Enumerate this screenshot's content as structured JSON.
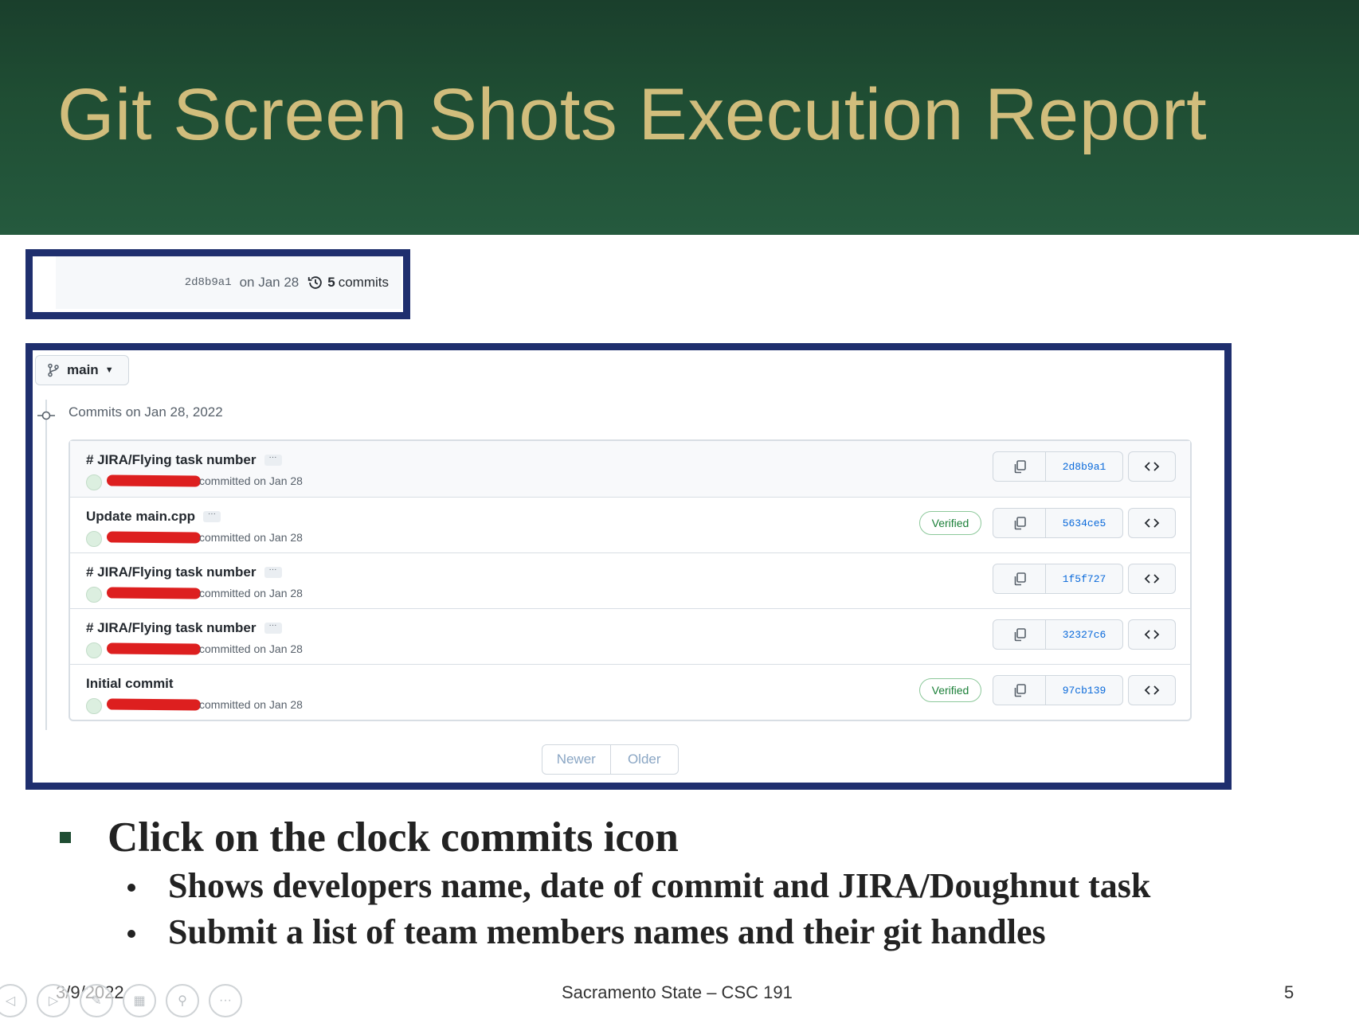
{
  "slide": {
    "title": "Git Screen Shots Execution Report",
    "footer_date": "3/9/2022",
    "footer_center": "Sacramento State – CSC 191",
    "page_number": "5"
  },
  "latest_commit": {
    "sha": "2d8b9a1",
    "date": "on Jan 28",
    "commits_count": "5",
    "commits_label": "commits"
  },
  "branch": {
    "name": "main"
  },
  "commit_group": {
    "date_label": "Commits on Jan 28, 2022"
  },
  "commits": [
    {
      "message": "# JIRA/Flying task number",
      "committed": "committed on Jan 28",
      "verified": "",
      "sha": "2d8b9a1"
    },
    {
      "message": "Update main.cpp",
      "committed": "committed on Jan 28",
      "verified": "Verified",
      "sha": "5634ce5"
    },
    {
      "message": "# JIRA/Flying task number",
      "committed": "committed on Jan 28",
      "verified": "",
      "sha": "1f5f727"
    },
    {
      "message": "# JIRA/Flying task number",
      "committed": "committed on Jan 28",
      "verified": "",
      "sha": "32327c6"
    },
    {
      "message": "Initial commit",
      "committed": "committed on Jan 28",
      "verified": "Verified",
      "sha": "97cb139"
    }
  ],
  "pagination": {
    "newer": "Newer",
    "older": "Older"
  },
  "bullets": {
    "main": "Click on the clock commits icon",
    "sub": [
      "Shows developers name, date of commit and JIRA/Doughnut task",
      "Submit a list of team members names and their git handles"
    ]
  },
  "icons": {
    "clock": "history-clock-icon",
    "branch": "git-branch-icon",
    "copy": "copy-icon",
    "browse": "code-icon"
  },
  "colors": {
    "header_green": "#1f4d33",
    "title_gold": "#d1bd7c",
    "frame_blue": "#1f2f6e",
    "link_blue": "#0969da",
    "verified_green": "#1a7f37",
    "redaction_red": "#dd1f1f"
  }
}
